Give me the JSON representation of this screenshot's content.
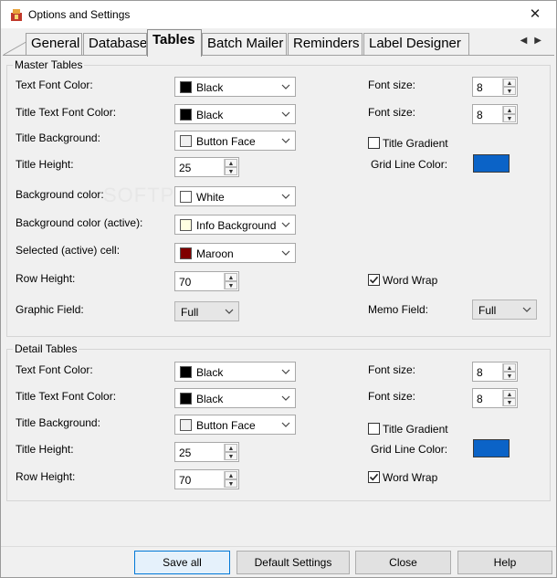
{
  "window": {
    "title": "Options and Settings",
    "close_glyph": "✕"
  },
  "tabs": [
    {
      "label": "General"
    },
    {
      "label": "Database"
    },
    {
      "label": "Tables"
    },
    {
      "label": "Batch Mailer"
    },
    {
      "label": "Reminders"
    },
    {
      "label": "Label Designer"
    }
  ],
  "tab_scroll": {
    "left": "◀",
    "right": "▶"
  },
  "watermark": "SOFTPEDIA",
  "master": {
    "legend": "Master Tables",
    "text_font_color": {
      "label": "Text Font Color:",
      "value": "Black",
      "swatch": "#000000"
    },
    "title_text_font_color": {
      "label": "Title Text Font Color:",
      "value": "Black",
      "swatch": "#000000"
    },
    "title_background": {
      "label": "Title Background:",
      "value": "Button Face",
      "swatch": "#f0f0f0"
    },
    "title_height": {
      "label": "Title Height:",
      "value": "25"
    },
    "background_color": {
      "label": "Background color:",
      "value": "White",
      "swatch": "#ffffff"
    },
    "background_color_active": {
      "label": "Background color (active):",
      "value": "Info Background",
      "swatch": "#ffffe1"
    },
    "selected_cell": {
      "label": "Selected (active) cell:",
      "value": "Maroon",
      "swatch": "#800000"
    },
    "row_height": {
      "label": "Row Height:",
      "value": "70"
    },
    "graphic_field": {
      "label": "Graphic Field:",
      "value": "Full"
    },
    "font_size_1": {
      "label": "Font size:",
      "value": "8"
    },
    "font_size_2": {
      "label": "Font size:",
      "value": "8"
    },
    "title_gradient": {
      "label": "Title Gradient",
      "checked": false
    },
    "grid_line_color": {
      "label": "Grid Line Color:",
      "color": "#0b63c7"
    },
    "word_wrap": {
      "label": "Word Wrap",
      "checked": true
    },
    "memo_field": {
      "label": "Memo Field:",
      "value": "Full"
    }
  },
  "detail": {
    "legend": "Detail Tables",
    "text_font_color": {
      "label": "Text Font Color:",
      "value": "Black",
      "swatch": "#000000"
    },
    "title_text_font_color": {
      "label": "Title Text Font Color:",
      "value": "Black",
      "swatch": "#000000"
    },
    "title_background": {
      "label": "Title Background:",
      "value": "Button Face",
      "swatch": "#f0f0f0"
    },
    "title_height": {
      "label": "Title Height:",
      "value": "25"
    },
    "row_height": {
      "label": "Row Height:",
      "value": "70"
    },
    "font_size_1": {
      "label": "Font size:",
      "value": "8"
    },
    "font_size_2": {
      "label": "Font size:",
      "value": "8"
    },
    "title_gradient": {
      "label": "Title Gradient",
      "checked": false
    },
    "grid_line_color": {
      "label": "Grid Line Color:",
      "color": "#0b63c7"
    },
    "word_wrap": {
      "label": "Word Wrap",
      "checked": true
    }
  },
  "footer": {
    "save_all": "Save all",
    "default_settings": "Default Settings",
    "close": "Close",
    "help": "Help"
  },
  "spin_glyphs": {
    "up": "▲",
    "down": "▼"
  }
}
